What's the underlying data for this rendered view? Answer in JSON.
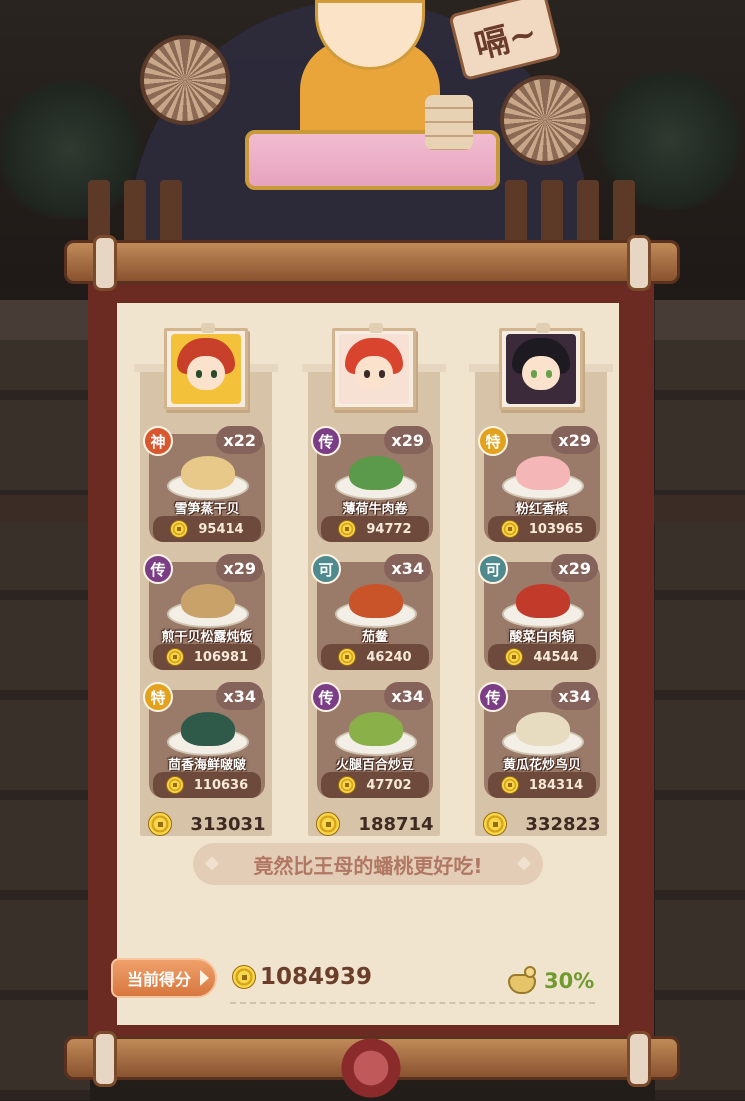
{
  "sign_text": "嗝~",
  "columns": [
    {
      "guest_icon": "deity-portrait-icon",
      "dishes": [
        {
          "grade": "神",
          "grade_class": "shen",
          "count": "x22",
          "name": "雪笋蒸干贝",
          "price": "95414",
          "food_color": "#e9c98a"
        },
        {
          "grade": "传",
          "grade_class": "chuan",
          "count": "x29",
          "name": "煎干贝松露炖饭",
          "price": "106981",
          "food_color": "#c9a26a"
        },
        {
          "grade": "特",
          "grade_class": "te",
          "count": "x34",
          "name": "茴香海鲜啵啵",
          "price": "110636",
          "food_color": "#2f5a4a"
        }
      ],
      "total": "313031"
    },
    {
      "guest_icon": "red-hair-girl-portrait-icon",
      "dishes": [
        {
          "grade": "传",
          "grade_class": "chuan",
          "count": "x29",
          "name": "薄荷牛肉卷",
          "price": "94772",
          "food_color": "#5a9a4a"
        },
        {
          "grade": "可",
          "grade_class": "ke",
          "count": "x34",
          "name": "茄鲞",
          "price": "46240",
          "food_color": "#c9542a"
        },
        {
          "grade": "传",
          "grade_class": "chuan",
          "count": "x34",
          "name": "火腿百合炒豆",
          "price": "47702",
          "food_color": "#8ab04a"
        }
      ],
      "total": "188714"
    },
    {
      "guest_icon": "dark-hair-girl-portrait-icon",
      "dishes": [
        {
          "grade": "特",
          "grade_class": "te",
          "count": "x29",
          "name": "粉红香槟",
          "price": "103965",
          "food_color": "#f4b6b6"
        },
        {
          "grade": "可",
          "grade_class": "ke",
          "count": "x29",
          "name": "酸菜白肉锅",
          "price": "44544",
          "food_color": "#c23a2a"
        },
        {
          "grade": "传",
          "grade_class": "chuan",
          "count": "x34",
          "name": "黄瓜花炒鸟贝",
          "price": "184314",
          "food_color": "#e8dcc0"
        }
      ],
      "total": "332823"
    }
  ],
  "comment": "竟然比王母的蟠桃更好吃!",
  "score": {
    "label": "当前得分",
    "value": "1084939",
    "bonus": "30%"
  },
  "colors": {
    "scroll_border": "#6b2a22",
    "paper": "#f1e4cf",
    "grade_shen": "#d9572f",
    "grade_chuan": "#7a3d86",
    "grade_te": "#e3a21e",
    "grade_ke": "#4f8a8e",
    "bonus_green": "#6e9a2e"
  }
}
